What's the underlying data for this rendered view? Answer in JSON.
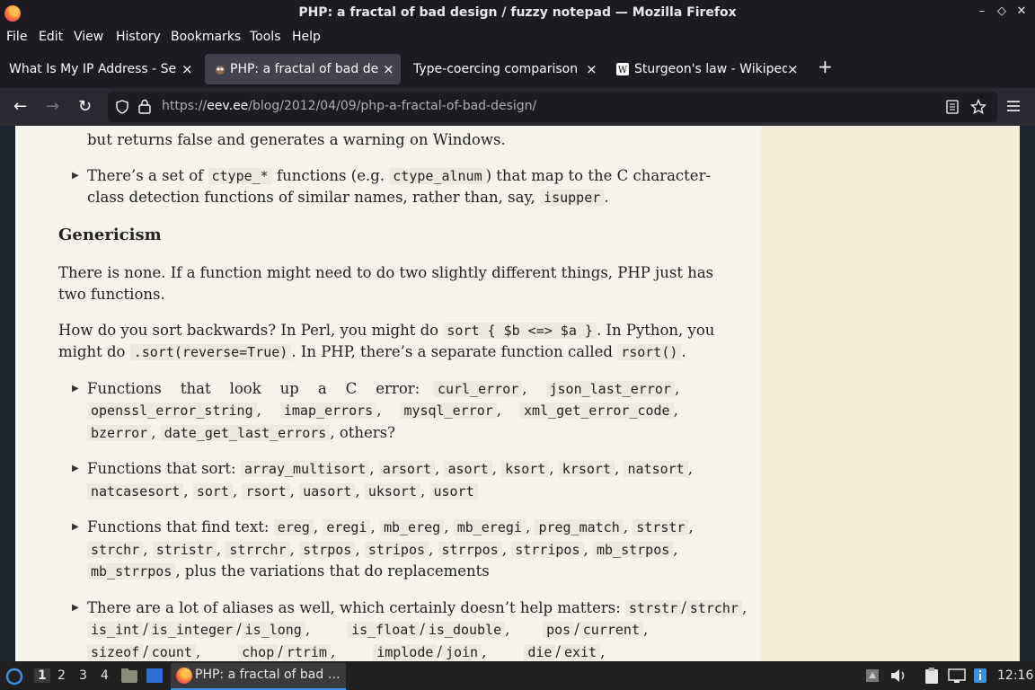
{
  "window": {
    "title": "PHP: a fractal of bad design / fuzzy notepad — Mozilla Firefox",
    "min": "–",
    "max": "◇",
    "close": "✕"
  },
  "menu": [
    "File",
    "Edit",
    "View",
    "History",
    "Bookmarks",
    "Tools",
    "Help"
  ],
  "tabs": [
    {
      "label": "What Is My IP Address - See",
      "close": "×"
    },
    {
      "label": "PHP: a fractal of bad desi",
      "close": "×"
    },
    {
      "label": "Type-coercing comparison o",
      "close": "×"
    },
    {
      "label": "Sturgeon's law - Wikipedi",
      "close": "×"
    }
  ],
  "newtab": "+",
  "nav": {
    "back": "←",
    "forward": "→",
    "reload": "↻",
    "url_scheme": "https://",
    "url_host": "eev.ee",
    "url_path": "/blog/2012/04/09/php-a-fractal-of-bad-design/"
  },
  "article": {
    "l0": "but returns false and generates a warning on Windows.",
    "b1a": "There’s a set of",
    "c_ctype": "ctype_*",
    "b1b": "functions (e.g.",
    "c_ctype_alnum": "ctype_alnum",
    "b1c": ") that map to the C character-",
    "b1d": "class detection functions of similar names, rather than, say,",
    "c_isupper": "isupper",
    "dot": ".",
    "heading": "Genericism",
    "p1a": "There is none. If a function might need to do two slightly different things, PHP just has",
    "p1b": "two functions.",
    "p2a": "How do you sort backwards? In Perl, you might do",
    "c_perl": "sort { $b <=> $a }",
    "p2b": ". In Python, you",
    "p2c": "might do",
    "c_py": ".sort(reverse=True)",
    "p2d": ". In PHP, there’s a separate function called",
    "c_rsort": "rsort()",
    "b2a": "Functions    that    look    up    a    C    error:",
    "c_curl_error": "curl_error",
    "c_json_last_error": "json_last_error",
    "c_openssl_error_string": "openssl_error_string",
    "c_imap_errors": "imap_errors",
    "c_mysql_error": "mysql_error",
    "c_xml_get_error_code": "xml_get_error_code",
    "c_bzerror": "bzerror",
    "c_date_get_last_errors": "date_get_last_errors",
    "b2b": ", others?",
    "b3a": "Functions that sort:",
    "sort_fns": [
      "array_multisort",
      "arsort",
      "asort",
      "ksort",
      "krsort",
      "natsort",
      "natcasesort",
      "sort",
      "rsort",
      "uasort",
      "uksort",
      "usort"
    ],
    "b4a": "Functions that find text:",
    "find_fns": [
      "ereg",
      "eregi",
      "mb_ereg",
      "mb_eregi",
      "preg_match",
      "strstr",
      "strchr",
      "stristr",
      "strrchr",
      "strpos",
      "stripos",
      "strrpos",
      "strripos",
      "mb_strpos",
      "mb_strrpos"
    ],
    "b4b": ", plus the variations that do replacements",
    "b5a": "There are a lot of aliases as well, which certainly doesn’t help matters:",
    "alias": [
      "strstr",
      "strchr",
      "is_int",
      "is_integer",
      "is_long",
      "is_float",
      "is_double",
      "pos",
      "current",
      "sizeof",
      "count",
      "chop",
      "rtrim",
      "implode",
      "join",
      "die",
      "exit"
    ],
    "slash": "/",
    "comma": ","
  },
  "taskbar": {
    "ws": [
      "1",
      "2",
      "3",
      "4"
    ],
    "app": "PHP: a fractal of bad …",
    "clock": "12:16"
  },
  "colors": {
    "page_bg": "#f6f3ed",
    "sidebar_bg": "#f4ecd9",
    "chrome_dark": "#1c1b22",
    "chrome_nav": "#2b2a33"
  }
}
